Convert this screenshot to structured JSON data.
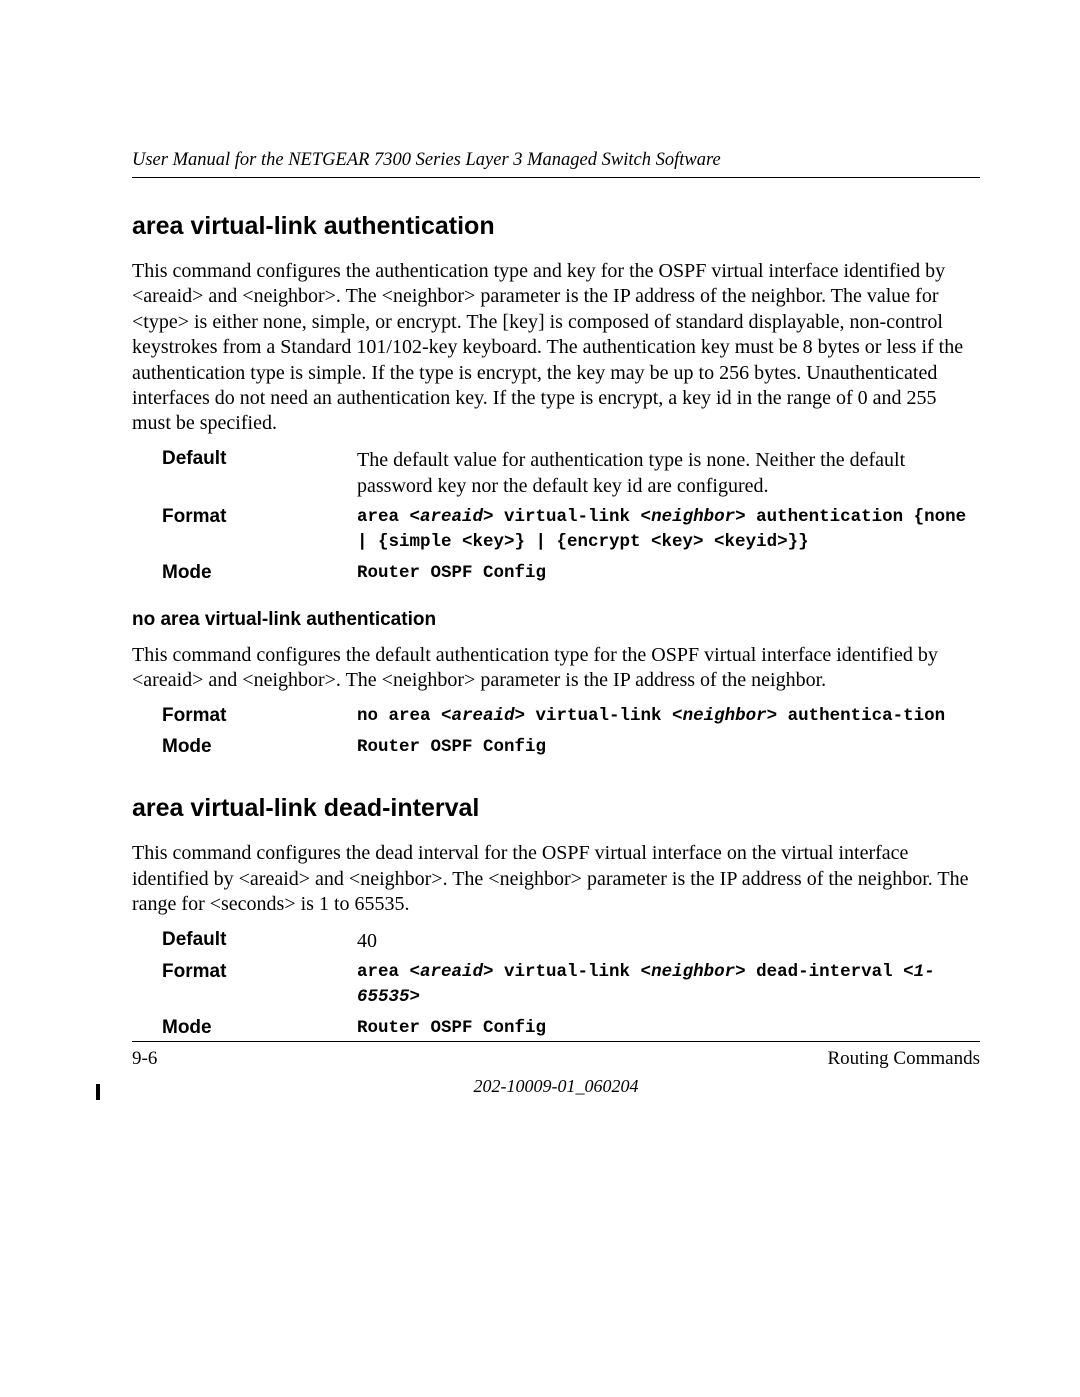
{
  "header": {
    "title": "User Manual for the NETGEAR 7300 Series Layer 3 Managed Switch Software"
  },
  "section1": {
    "heading": "area virtual-link authentication",
    "body": "This command configures the authentication type and key for the OSPF virtual interface identified by <areaid> and <neighbor>. The <neighbor> parameter is the IP address of the neighbor. The value for <type> is either none, simple, or encrypt. The [key] is composed of standard displayable, non-control keystrokes from a Standard 101/102-key keyboard. The authentication key must be 8 bytes or less if the authentication type is simple. If the type is encrypt, the key may be up to 256 bytes. Unauthenticated interfaces do not need an authentication key. If the type is encrypt, a key id in the range of 0 and 255 must be specified.",
    "rows": {
      "default_label": "Default",
      "default_value": "The default value for authentication type is none. Neither the default password key nor the default key id are configured.",
      "format_label": "Format",
      "format_pre": "area <",
      "format_areaid": "areaid",
      "format_mid1": "> virtual-link <",
      "format_neighbor": "neighbor",
      "format_post1": "> authentication {none | {simple <key>} | {encrypt <key> <keyid>}}",
      "mode_label": "Mode",
      "mode_value": "Router OSPF Config"
    },
    "sub": {
      "heading": "no area virtual-link authentication",
      "body": "This command configures the default authentication type for the OSPF virtual interface identified by <areaid> and <neighbor>. The <neighbor> parameter is the IP address of the neighbor.",
      "rows": {
        "format_label": "Format",
        "format_pre": "no area <",
        "format_areaid": "areaid",
        "format_mid1": "> virtual-link <",
        "format_neighbor": "neighbor",
        "format_post1": "> authentica-tion",
        "mode_label": "Mode",
        "mode_value": "Router OSPF Config"
      }
    }
  },
  "section2": {
    "heading": "area virtual-link dead-interval",
    "body": "This command configures the dead interval for the OSPF virtual interface on the virtual interface identified by <areaid> and <neighbor>. The <neighbor> parameter is the IP address of the neighbor. The range for <seconds> is 1 to 65535.",
    "rows": {
      "default_label": "Default",
      "default_value": "40",
      "format_label": "Format",
      "format_pre": "area <",
      "format_areaid": "areaid",
      "format_mid1": "> virtual-link <",
      "format_neighbor": "neighbor",
      "format_post1": "> dead-interval <",
      "format_range": "1-65535",
      "format_post2": ">",
      "mode_label": "Mode",
      "mode_value": "Router OSPF Config"
    }
  },
  "footer": {
    "page": "9-6",
    "section": "Routing Commands",
    "docid": "202-10009-01_060204"
  }
}
